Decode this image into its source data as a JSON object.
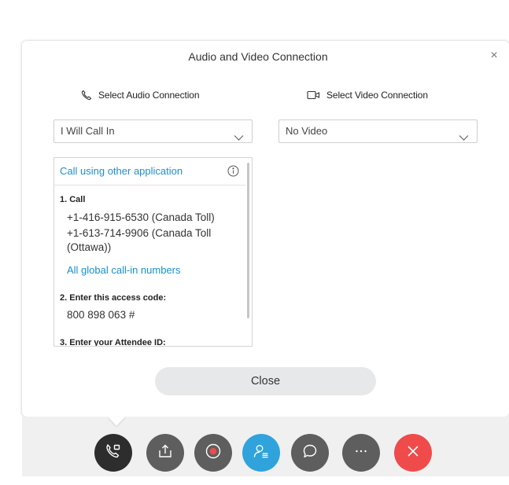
{
  "dialog": {
    "title": "Audio and Video Connection",
    "close_glyph": "×"
  },
  "audio": {
    "heading": "Select Audio Connection",
    "heading_icon": "phone-icon",
    "selected": "I Will Call In"
  },
  "video": {
    "heading": "Select Video Connection",
    "heading_icon": "camera-icon",
    "selected": "No Video"
  },
  "call_panel": {
    "other_app_link": "Call using other application",
    "info_icon": "info-icon",
    "step1": "1. Call",
    "phones": [
      "+1-416-915-6530 (Canada Toll)",
      "+1-613-714-9906 (Canada Toll (Ottawa))"
    ],
    "global_link": "All global call-in numbers",
    "step2": "2. Enter this access code:",
    "access_code": "800 898 063 #",
    "step3": "3. Enter your Attendee ID:"
  },
  "close_button": "Close",
  "toolbar": {
    "buttons": [
      {
        "icon": "audio-connection-icon",
        "color": "#2d2d2d"
      },
      {
        "icon": "share-icon",
        "color": "#5e5e5e"
      },
      {
        "icon": "record-icon",
        "color": "#5e5e5e"
      },
      {
        "icon": "participants-icon",
        "color": "#30a3dc"
      },
      {
        "icon": "chat-icon",
        "color": "#5e5e5e"
      },
      {
        "icon": "more-icon",
        "color": "#5e5e5e"
      },
      {
        "icon": "leave-icon",
        "color": "#ef4b4b"
      }
    ]
  },
  "colors": {
    "link": "#1a8fd0",
    "accent_blue": "#30a3dc",
    "danger": "#ef4b4b"
  }
}
